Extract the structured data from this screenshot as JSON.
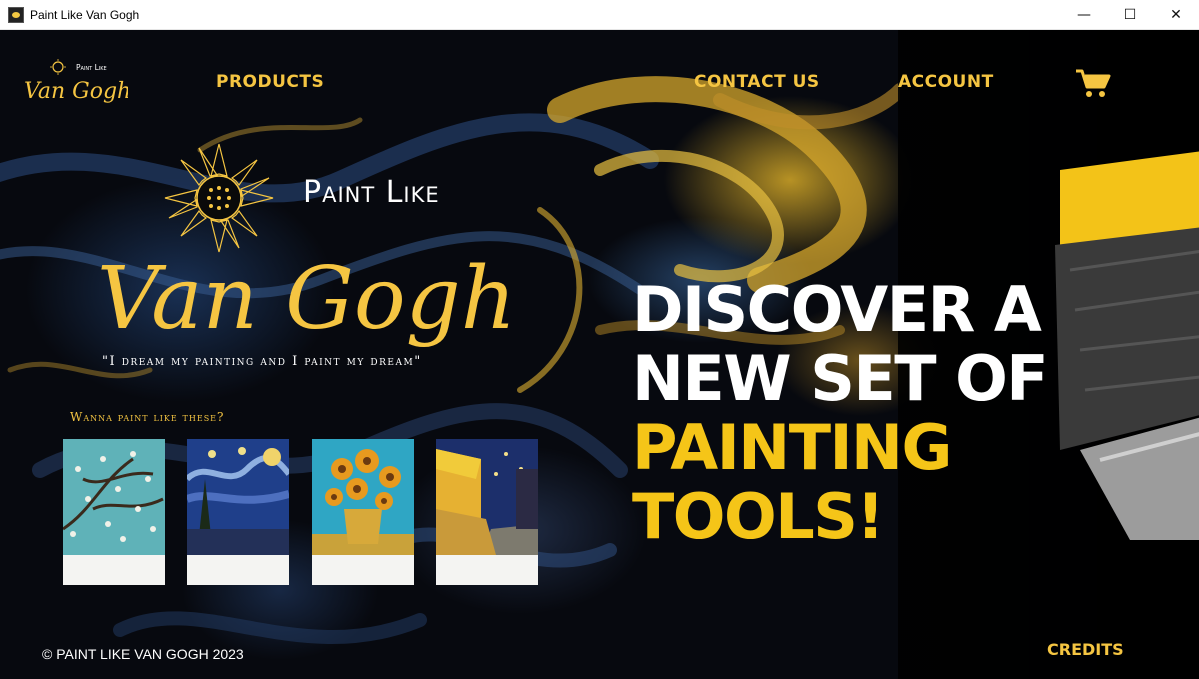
{
  "window": {
    "title": "Paint Like Van Gogh",
    "minimize": "—",
    "maximize": "☐",
    "close": "✕"
  },
  "nav": {
    "logo_top": "Paint Like",
    "logo_script": "Van Gogh",
    "products": "PRODUCTS",
    "contact": "CONTACT US",
    "account": "ACCOUNT",
    "cart_icon": "cart-icon"
  },
  "hero": {
    "logo_top": "Paint Like",
    "logo_script": "Van Gogh",
    "quote": "\"I dream my painting and I paint my dream\"",
    "wanna": "Wanna paint like these?",
    "paintings": [
      {
        "name": "almond-blossoms"
      },
      {
        "name": "starry-night"
      },
      {
        "name": "sunflowers"
      },
      {
        "name": "cafe-terrace-at-night"
      }
    ],
    "headline_line1": "DISCOVER A",
    "headline_line2": "NEW SET OF",
    "headline_line3": "PAINTING TOOLS!"
  },
  "footer": {
    "copyright": "© PAINT LIKE VAN GOGH 2023",
    "credits": "CREDITS"
  },
  "colors": {
    "accent": "#f5c542",
    "headline_yellow": "#f5c518",
    "background": "#07090f"
  }
}
